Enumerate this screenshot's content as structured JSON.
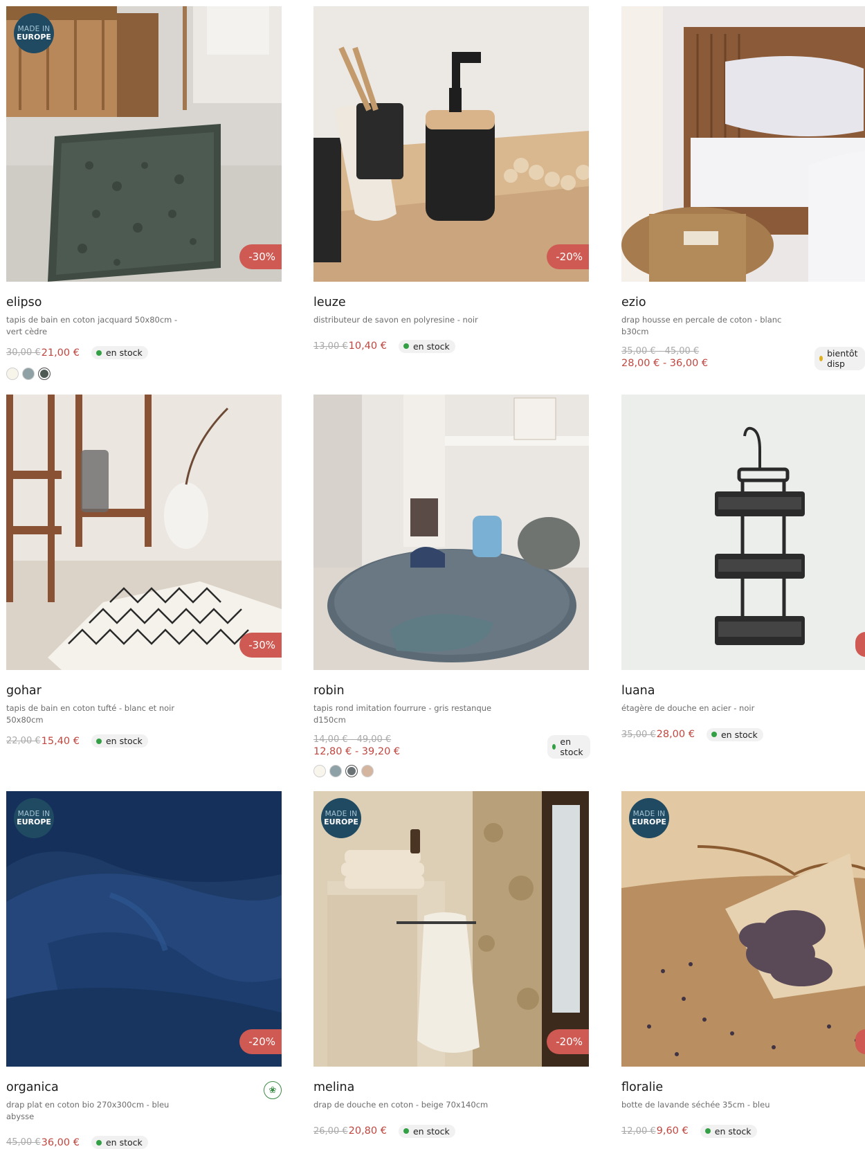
{
  "badges": {
    "made_in_line1": "MADE IN",
    "made_in_line2": "EUROPE"
  },
  "products": [
    {
      "name": "elipso",
      "desc": "tapis de bain en coton jacquard 50x80cm - vert cèdre",
      "old": "30,00 €",
      "new": "21,00 €",
      "stock": "en stock",
      "discount": "-30%",
      "swatches": [
        "#f7f5ea",
        "#8fa1a5",
        "#4e5a53"
      ]
    },
    {
      "name": "leuze",
      "desc": "distributeur de savon en polyresine - noir",
      "old": "13,00 €",
      "new": "10,40 €",
      "stock": "en stock",
      "discount": "-20%"
    },
    {
      "name": "ezio",
      "desc": "drap housse en percale de coton - blanc b30cm",
      "old": "35,00 € - 45,00 €",
      "new": "28,00 € - 36,00 €",
      "stock": "bientôt disp"
    },
    {
      "name": "gohar",
      "desc": "tapis de bain en coton tufté - blanc et noir 50x80cm",
      "old": "22,00 €",
      "new": "15,40 €",
      "stock": "en stock",
      "discount": "-30%"
    },
    {
      "name": "robin",
      "desc": "tapis rond imitation fourrure - gris restanque d150cm",
      "old": "14,00 € - 49,00 €",
      "new": "12,80 € - 39,20 €",
      "stock": "en stock",
      "swatches": [
        "#f8f6ec",
        "#8ea1a6",
        "#6b7276",
        "#d4b5a0"
      ]
    },
    {
      "name": "luana",
      "desc": "étagère de douche en acier - noir",
      "old": "35,00 €",
      "new": "28,00 €",
      "stock": "en stock"
    },
    {
      "name": "organica",
      "desc": "drap plat en coton bio 270x300cm - bleu abysse",
      "old": "45,00 €",
      "new": "36,00 €",
      "stock": "en stock",
      "discount": "-20%"
    },
    {
      "name": "melina",
      "desc": "drap de douche en coton - beige 70x140cm",
      "old": "26,00 €",
      "new": "20,80 €",
      "stock": "en stock",
      "discount": "-20%"
    },
    {
      "name": "floralie",
      "desc": "botte de lavande séchée 35cm - bleu",
      "old": "12,00 €",
      "new": "9,60 €",
      "stock": "en stock"
    }
  ],
  "colors": {
    "discount": "#cf5a53",
    "price": "#c0463f",
    "badge": "#1f4a62",
    "in_stock": "#33a046",
    "soon": "#e0b022"
  }
}
